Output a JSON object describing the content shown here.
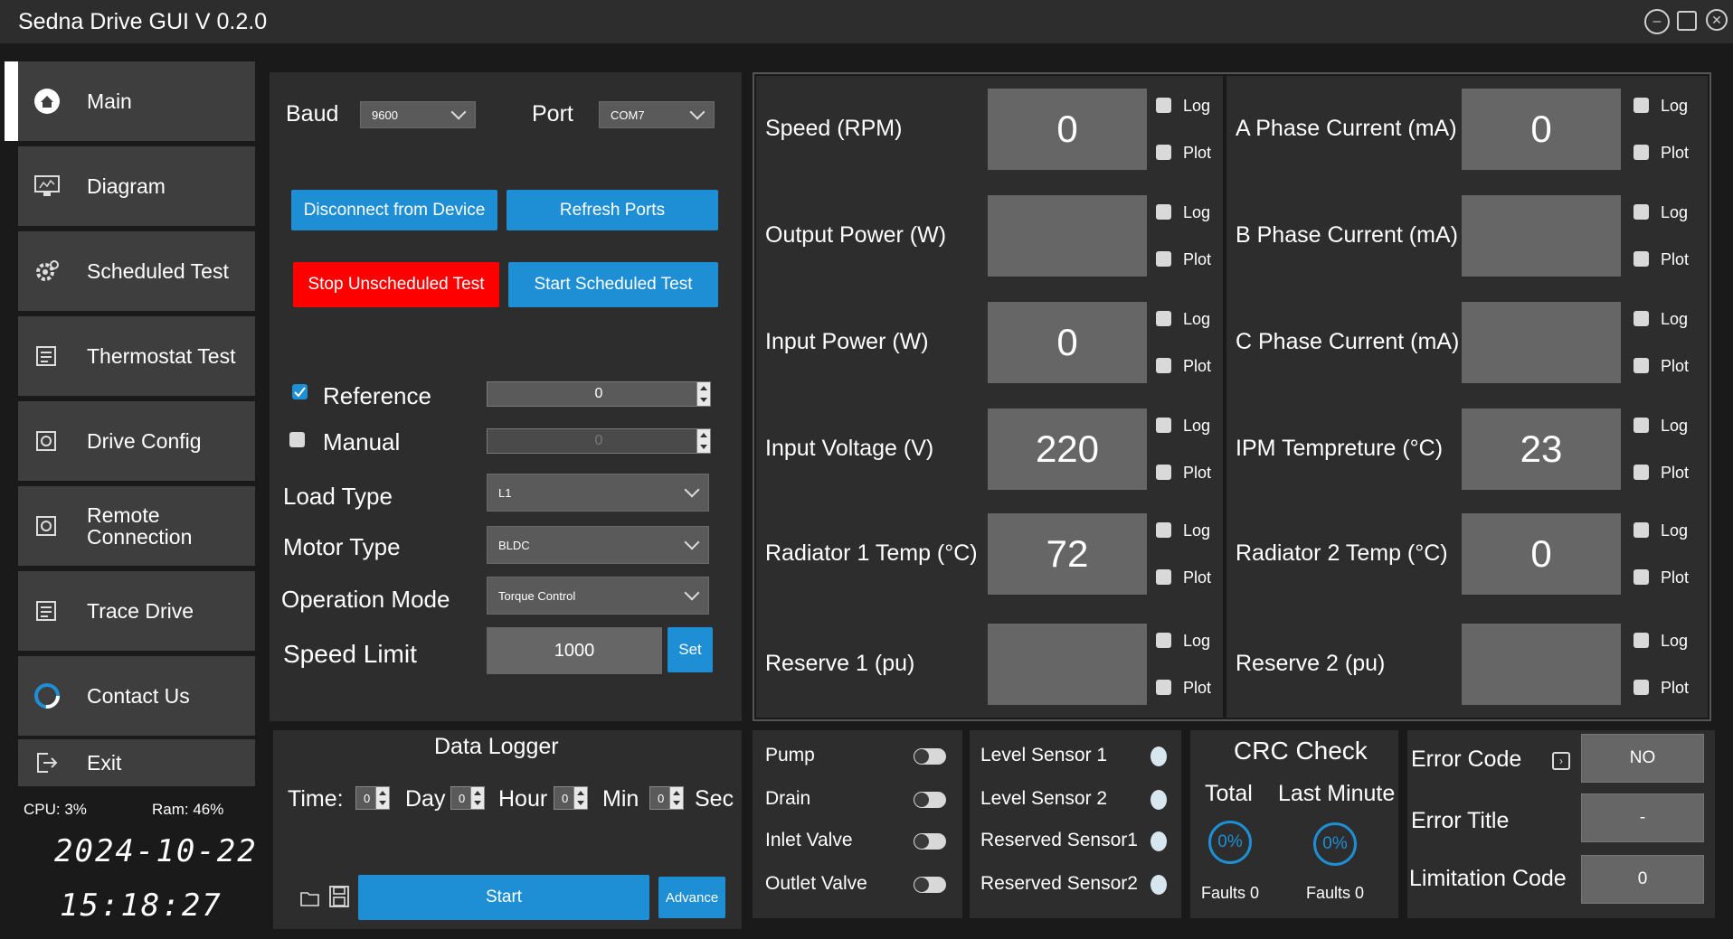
{
  "window": {
    "title": "Sedna Drive GUI V 0.2.0"
  },
  "sidebar": {
    "items": [
      {
        "label": "Main"
      },
      {
        "label": "Diagram"
      },
      {
        "label": "Scheduled Test"
      },
      {
        "label": "Thermostat  Test"
      },
      {
        "label": "Drive Config"
      },
      {
        "label": "Remote\nConnection",
        "line1": "Remote",
        "line2": "Connection"
      },
      {
        "label": "Trace Drive"
      },
      {
        "label": "Contact Us"
      },
      {
        "label": "Exit"
      }
    ],
    "cpu": "CPU: 3%",
    "ram": "Ram: 46%",
    "date": "2024-10-22",
    "time": "15:18:27"
  },
  "connection": {
    "baud_label": "Baud",
    "baud_value": "9600",
    "port_label": "Port",
    "port_value": "COM7",
    "disconnect": "Disconnect from Device",
    "refresh": "Refresh Ports",
    "stop_unscheduled": "Stop Unscheduled Test",
    "start_scheduled": "Start Scheduled Test"
  },
  "control": {
    "reference_label": "Reference",
    "reference_value": "0",
    "manual_label": "Manual",
    "manual_value": "0",
    "load_type_label": "Load Type",
    "load_type_value": "L1",
    "motor_type_label": "Motor Type",
    "motor_type_value": "BLDC",
    "operation_mode_label": "Operation Mode",
    "operation_mode_value": "Torque Control",
    "speed_limit_label": "Speed Limit",
    "speed_limit_value": "1000",
    "set": "Set"
  },
  "readings_left": [
    {
      "label": "Speed (RPM)",
      "value": "0"
    },
    {
      "label": "Output Power (W)",
      "value": ""
    },
    {
      "label": "Input Power (W)",
      "value": "0"
    },
    {
      "label": "Input Voltage (V)",
      "value": "220"
    },
    {
      "label": "Radiator 1 Temp (°C)",
      "value": "72"
    },
    {
      "label": "Reserve 1 (pu)",
      "value": ""
    }
  ],
  "readings_right": [
    {
      "label": "A Phase Current (mA)",
      "value": "0"
    },
    {
      "label": "B Phase Current (mA)",
      "value": ""
    },
    {
      "label": "C Phase Current (mA)",
      "value": ""
    },
    {
      "label": "IPM Tempreture (°C)",
      "value": "23"
    },
    {
      "label": "Radiator 2 Temp (°C)",
      "value": "0"
    },
    {
      "label": "Reserve 2 (pu)",
      "value": ""
    }
  ],
  "log_label": "Log",
  "plot_label": "Plot",
  "logger": {
    "title": "Data Logger",
    "time_label": "Time:",
    "day_value": "0",
    "day_label": "Day",
    "hour_value": "0",
    "hour_label": "Hour",
    "min_value": "0",
    "min_label": "Min",
    "sec_value": "0",
    "sec_label": "Sec",
    "start": "Start",
    "advance": "Advance"
  },
  "actuators": [
    {
      "label": "Pump"
    },
    {
      "label": "Drain"
    },
    {
      "label": "Inlet Valve"
    },
    {
      "label": "Outlet Valve"
    }
  ],
  "sensors": [
    {
      "label": "Level Sensor 1"
    },
    {
      "label": "Level Sensor 2"
    },
    {
      "label": "Reserved Sensor1"
    },
    {
      "label": "Reserved Sensor2"
    }
  ],
  "crc": {
    "title": "CRC Check",
    "total_label": "Total",
    "last_minute_label": "Last Minute",
    "total_pct": "0%",
    "last_minute_pct": "0%",
    "total_faults": "Faults 0",
    "last_minute_faults": "Faults 0"
  },
  "errors": {
    "error_code_label": "Error Code",
    "error_code_value": "NO",
    "error_title_label": "Error Title",
    "error_title_value": "-",
    "limitation_code_label": "Limitation Code",
    "limitation_code_value": "0"
  },
  "colors": {
    "accent": "#1e8fd5",
    "danger": "#ff0000",
    "panel": "#2d2d2d",
    "value_box": "#666666"
  }
}
